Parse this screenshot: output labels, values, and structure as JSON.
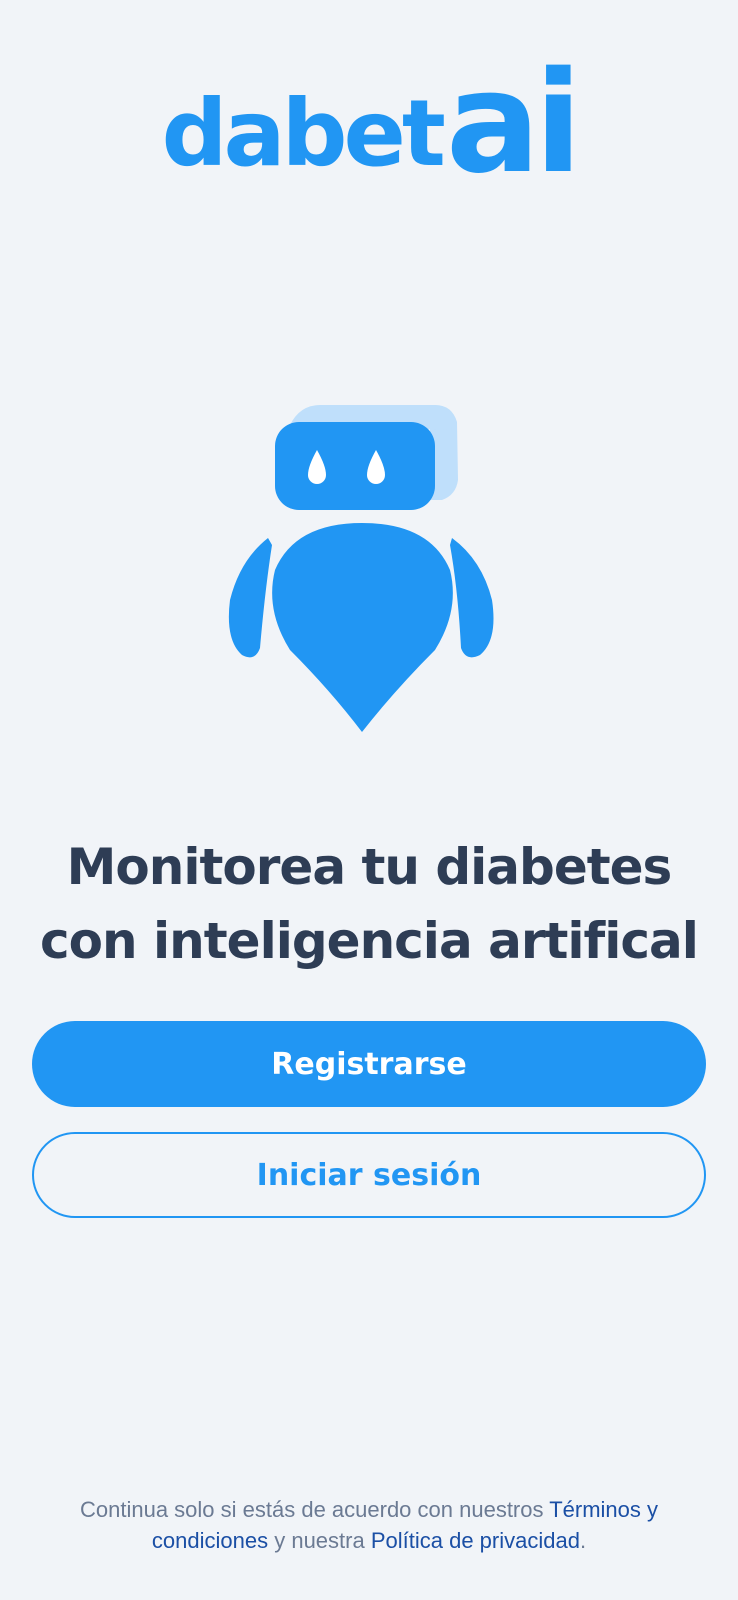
{
  "logo": {
    "word": "dabet",
    "accent": "ai"
  },
  "headline": {
    "line1": "Monitorea tu diabetes",
    "line2": "con inteligencia artifical"
  },
  "buttons": {
    "register": "Registrarse",
    "login": "Iniciar sesión"
  },
  "legal": {
    "prefix": "Continua solo si estás de acuerdo con nuestros ",
    "terms_link": "Términos y condiciones",
    "middle": " y nuestra ",
    "privacy_link": "Política de privacidad",
    "suffix": "."
  },
  "colors": {
    "brand": "#2196f3",
    "brand_light": "#bfdffb",
    "headline": "#2e3d55",
    "link": "#1b4fa5",
    "muted": "#6b7a93",
    "background": "#f1f4f8"
  },
  "icons": {
    "mascot": "robot-drop-mascot-icon"
  }
}
